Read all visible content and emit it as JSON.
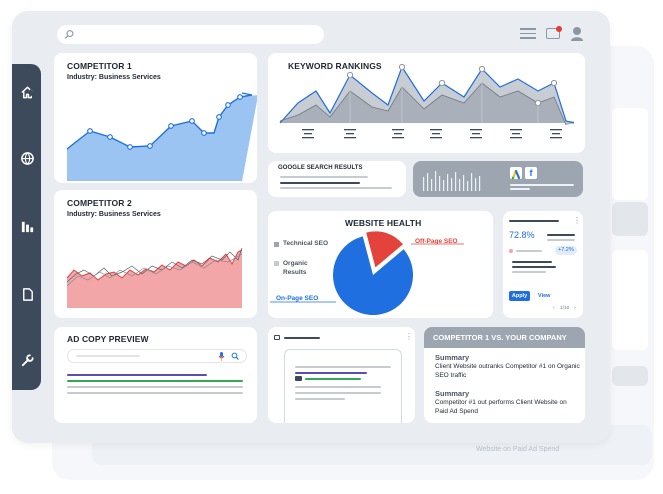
{
  "competitor1": {
    "title": "COMPETITOR 1",
    "industry": "Industry: Business Services"
  },
  "competitor2": {
    "title": "COMPETITOR 2",
    "industry": "Industry: Business Services"
  },
  "keyword_rankings": {
    "title": "KEYWORD RANKINGS"
  },
  "google_search": {
    "title": "GOOGLE SEARCH RESULTS"
  },
  "website_health": {
    "title": "WEBSITE HEALTH",
    "legend": {
      "technical": "Technical SEO",
      "organic": "Organic Results",
      "onpage": "On-Page SEO",
      "offpage": "Off-Page SEO"
    },
    "chart_data": {
      "type": "pie",
      "categories": [
        "On-Page SEO",
        "Off-Page SEO"
      ],
      "values": [
        82,
        18
      ]
    }
  },
  "stats_card": {
    "percent": "72.8%",
    "delta": "+7.2%",
    "apply_label": "Apply",
    "view_label": "View",
    "pager": "1/10"
  },
  "ad_copy": {
    "title": "AD COPY PREVIEW"
  },
  "comparison": {
    "title": "COMPETITOR 1 VS. YOUR COMPANY",
    "summary1_title": "Summary",
    "summary1_text": "Client Website outranks Competitor #1 on Organic SEO traffic",
    "summary2_title": "Summary",
    "summary2_text": "Competitor #1 out performs Client Website on Paid Ad Spend"
  },
  "background": {
    "ghost_text": "Website on Paid Ad Spend"
  },
  "colors": {
    "accent_blue": "#1f6fe0",
    "chart_fill_blue": "#9cc4f2",
    "chart_fill_red": "#f3a6a8",
    "offpage_red": "#e3433b",
    "sidebar": "#3c4a5c"
  }
}
